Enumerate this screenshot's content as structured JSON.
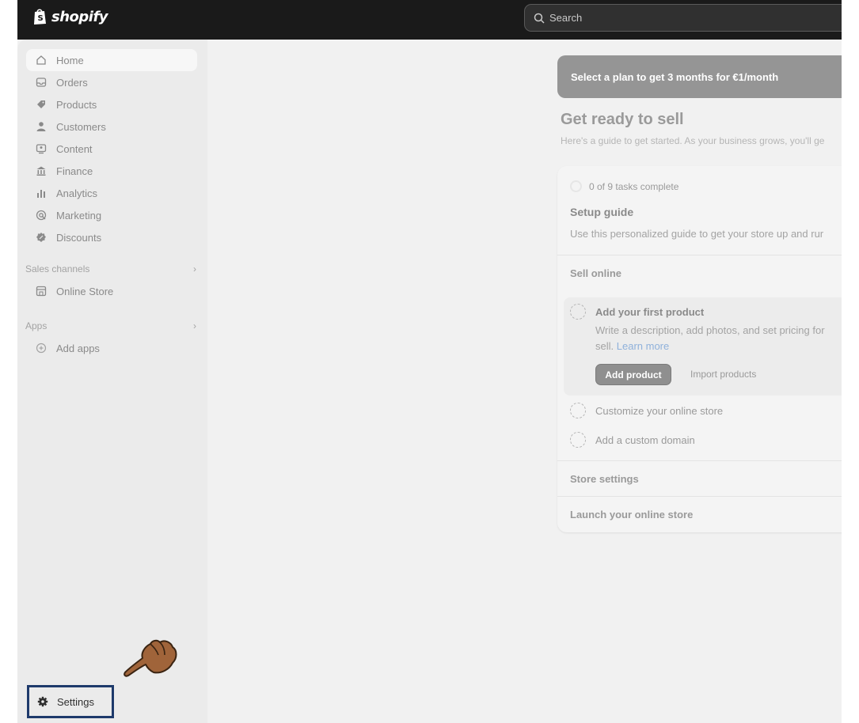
{
  "topbar": {
    "brand": "shopify",
    "search_placeholder": "Search"
  },
  "sidebar": {
    "items": [
      {
        "label": "Home",
        "icon": "home-icon"
      },
      {
        "label": "Orders",
        "icon": "inbox-icon"
      },
      {
        "label": "Products",
        "icon": "tag-icon"
      },
      {
        "label": "Customers",
        "icon": "person-icon"
      },
      {
        "label": "Content",
        "icon": "image-icon"
      },
      {
        "label": "Finance",
        "icon": "bank-icon"
      },
      {
        "label": "Analytics",
        "icon": "bar-chart-icon"
      },
      {
        "label": "Marketing",
        "icon": "target-icon"
      },
      {
        "label": "Discounts",
        "icon": "discount-icon"
      }
    ],
    "sales_channels": {
      "heading": "Sales channels",
      "items": [
        {
          "label": "Online Store",
          "icon": "store-icon"
        }
      ]
    },
    "apps": {
      "heading": "Apps",
      "items": [
        {
          "label": "Add apps",
          "icon": "plus-circle-icon"
        }
      ]
    },
    "settings_label": "Settings"
  },
  "main": {
    "banner": "Select a plan to get 3 months for €1/month",
    "heading": "Get ready to sell",
    "subheading": "Here's a guide to get started. As your business grows, you'll ge",
    "setup": {
      "progress": "0 of 9 tasks complete",
      "title": "Setup guide",
      "description": "Use this personalized guide to get your store up and rur",
      "sell_online": "Sell online",
      "task1_title": "Add your first product",
      "task1_desc": "Write a description, add photos, and set pricing for",
      "task1_desc2": "sell.",
      "task1_link": "Learn more",
      "add_product": "Add product",
      "import_products": "Import products",
      "task2": "Customize your online store",
      "task3": "Add a custom domain",
      "store_settings": "Store settings",
      "launch": "Launch your online store"
    }
  },
  "colors": {
    "topbar": "#1a1a1a",
    "sidebar": "#ebebeb",
    "settings_highlight": "#1e3a6b",
    "hand": "#a0643a"
  }
}
